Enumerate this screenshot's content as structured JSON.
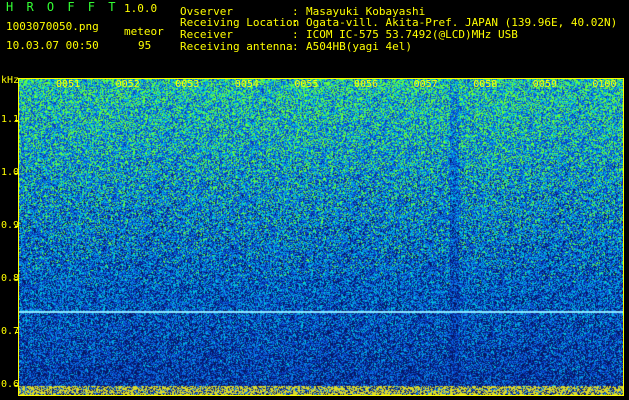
{
  "header": {
    "app_title": "H R O F F T",
    "app_version": "1.0.0",
    "file_name": "1003070050.png",
    "event_label": "meteor",
    "date_time": "10.03.07 00:50",
    "event_count": "95"
  },
  "station": [
    {
      "key": "Ovserver",
      "value": "Masayuki Kobayashi"
    },
    {
      "key": "Receiving Location",
      "value": "Ogata-vill. Akita-Pref. JAPAN (139.96E, 40.02N)"
    },
    {
      "key": "Receiver",
      "value": "ICOM IC-575 53.7492(@LCD)MHz USB"
    },
    {
      "key": "Receiving antenna",
      "value": "A504HB(yagi 4el)"
    }
  ],
  "chart_data": {
    "type": "heatmap",
    "ylabel": "kHz",
    "y_ticks": [
      "1.1",
      "1.0",
      "0.9",
      "0.8",
      "0.7",
      "0.6"
    ],
    "x_ticks": [
      "0051",
      "0052",
      "0053",
      "0054",
      "0055",
      "0056",
      "0057",
      "0058",
      "0059",
      "0100"
    ],
    "ylim": [
      0.58,
      1.18
    ],
    "carrier_line_khz": 0.74,
    "colors": {
      "low": "#061560",
      "mid": "#00c8ff",
      "high": "#66ff33",
      "axis": "#ffff00"
    }
  }
}
